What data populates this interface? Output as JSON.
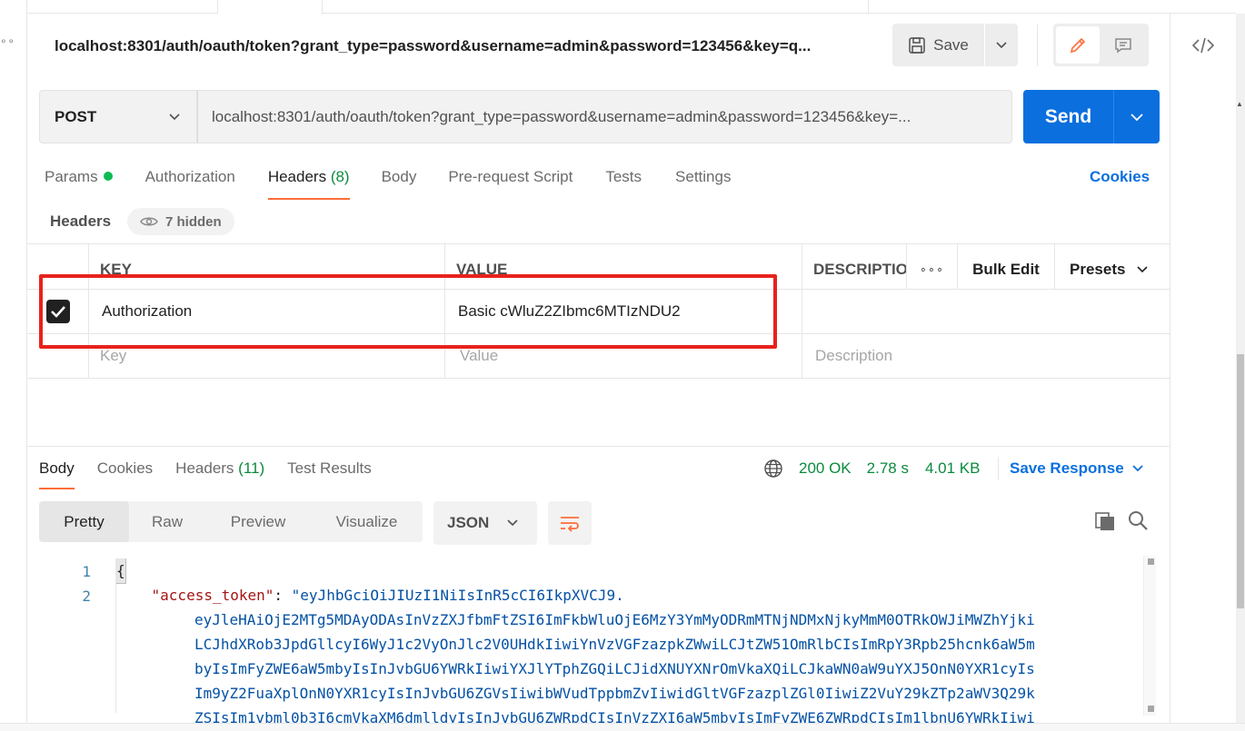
{
  "request": {
    "title": "localhost:8301/auth/oauth/token?grant_type=password&username=admin&password=123456&key=q...",
    "save_label": "Save",
    "method": "POST",
    "url": "localhost:8301/auth/oauth/token?grant_type=password&username=admin&password=123456&key=...",
    "send_label": "Send"
  },
  "req_tabs": {
    "params": "Params",
    "authorization": "Authorization",
    "headers": "Headers",
    "headers_count": "(8)",
    "body": "Body",
    "prerequest": "Pre-request Script",
    "tests": "Tests",
    "settings": "Settings",
    "cookies": "Cookies"
  },
  "headers_section": {
    "label": "Headers",
    "hidden": "7 hidden"
  },
  "table": {
    "col_key": "KEY",
    "col_value": "VALUE",
    "col_description": "DESCRIPTIO",
    "bulk_edit": "Bulk Edit",
    "presets": "Presets",
    "rows": [
      {
        "key": "Authorization",
        "value": "Basic cWluZ2ZIbmc6MTIzNDU2",
        "description": ""
      }
    ],
    "placeholder_key": "Key",
    "placeholder_value": "Value",
    "placeholder_description": "Description"
  },
  "response": {
    "tab_body": "Body",
    "tab_cookies": "Cookies",
    "tab_headers": "Headers",
    "headers_count": "(11)",
    "tab_tests": "Test Results",
    "status": "200 OK",
    "time": "2.78 s",
    "size": "4.01 KB",
    "save_response": "Save Response",
    "view_pretty": "Pretty",
    "view_raw": "Raw",
    "view_preview": "Preview",
    "view_visualize": "Visualize",
    "format": "JSON",
    "line1_num": "1",
    "line2_num": "2",
    "line1": "{",
    "key": "\"access_token\"",
    "colon": ": ",
    "token_lines": [
      "\"eyJhbGciOiJIUzI1NiIsInR5cCI6IkpXVCJ9.",
      "eyJleHAiOjE2MTg5MDAyODAsInVzZXJfbmFtZSI6ImFkbWluOjE6MzY3YmMyODRmMTNjNDMxNjkyMmM0OTRkOWJiMWZhYjki",
      "LCJhdXRob3JpdGllcyI6WyJ1c2VyOnJlc2V0UHdkIiwiYnVzVGFzazpkZWwiLCJtZW51OmRlbCIsImRpY3Rpb25hcnk6aW5m",
      "byIsImFyZWE6aW5mbyIsInJvbGU6YWRkIiwiYXJlYTphZGQiLCJidXNUYXNrOmVkaXQiLCJkaWN0aW9uYXJ5OnN0YXR1cyIs",
      "Im9yZ2FuaXplOnN0YXR1cyIsInJvbGU6ZGVsIiwibWVudTppbmZvIiwidGltVGFzazplZGl0IiwiZ2VuY29kZTp2aWV3Q29k",
      "ZSIsIm1vbml0b3I6cmVkaXM6dmlldyIsInJvbGU6ZWRpdCIsInVzZXI6aW5mbyIsImFyZWE6ZWRpdCIsIm1lbnU6YWRkIiwi"
    ]
  },
  "icons": {
    "save": "floppy-disk-icon",
    "edit": "pencil-icon",
    "comment": "comment-icon",
    "code": "code-icon",
    "eye": "eye-icon",
    "globe": "globe-icon",
    "copy": "copy-icon",
    "search": "search-icon",
    "wrap": "word-wrap-icon",
    "more": "more-horizontal-icon"
  },
  "colors": {
    "accent_orange": "#ff6c37",
    "primary_blue": "#0b6fde",
    "status_green": "#0a8a3e",
    "highlight_red": "#e8221c"
  }
}
